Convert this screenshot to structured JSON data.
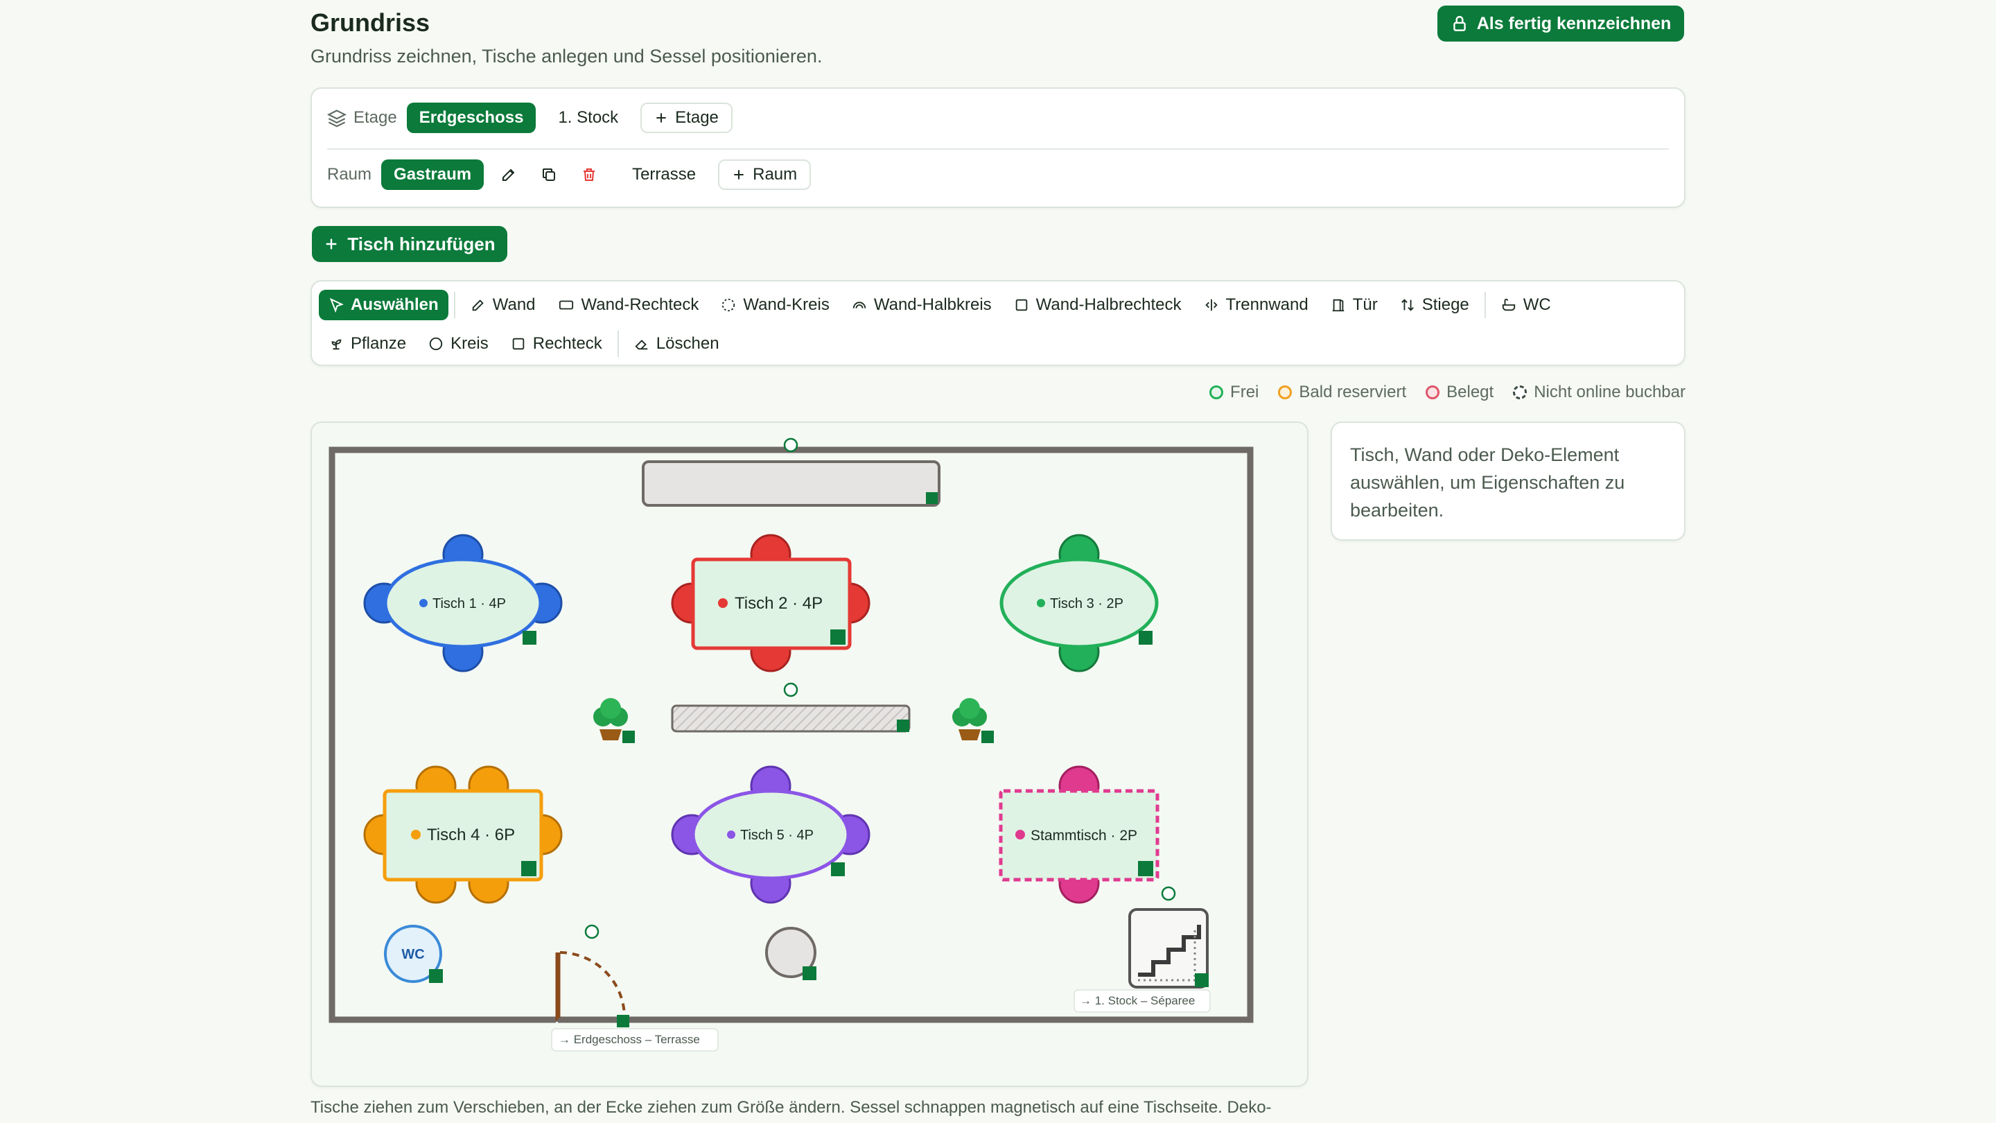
{
  "header": {
    "title": "Grundriss",
    "subtitle": "Grundriss zeichnen, Tische anlegen und Sessel positionieren.",
    "done_button": "Als fertig kennzeichnen"
  },
  "floors": {
    "label": "Etage",
    "items": [
      "Erdgeschoss",
      "1. Stock"
    ],
    "active": "Erdgeschoss",
    "add_label": "Etage"
  },
  "rooms": {
    "label": "Raum",
    "items": [
      "Gastraum",
      "Terrasse"
    ],
    "active": "Gastraum",
    "add_label": "Raum"
  },
  "add_table_button": "Tisch hinzufügen",
  "tools": {
    "row1": [
      {
        "label": "Auswählen",
        "icon": "cursor-icon",
        "active": true
      },
      {
        "label": "Wand",
        "icon": "pencil-icon"
      },
      {
        "label": "Wand-Rechteck",
        "icon": "rectangle-icon"
      },
      {
        "label": "Wand-Kreis",
        "icon": "dashed-circle-icon"
      },
      {
        "label": "Wand-Halbkreis",
        "icon": "half-circle-icon"
      },
      {
        "label": "Wand-Halbrechteck",
        "icon": "square-icon"
      },
      {
        "label": "Trennwand",
        "icon": "divider-icon"
      },
      {
        "label": "Tür",
        "icon": "door-icon"
      },
      {
        "label": "Stiege",
        "icon": "stairs-arrows-icon"
      },
      {
        "label": "WC",
        "icon": "bathtub-icon"
      }
    ],
    "row2": [
      {
        "label": "Pflanze",
        "icon": "sprout-icon"
      },
      {
        "label": "Kreis",
        "icon": "circle-icon"
      },
      {
        "label": "Rechteck",
        "icon": "square-icon"
      },
      {
        "label": "Löschen",
        "icon": "eraser-icon"
      }
    ]
  },
  "legend": {
    "free": "Frei",
    "soon": "Bald reserviert",
    "occupied": "Belegt",
    "offline": "Nicht online buchbar",
    "colors": {
      "free": "#22b05a",
      "soon": "#f0a020",
      "occupied": "#e0566a",
      "offline": "#3a4a40"
    }
  },
  "tables": [
    {
      "label": "Tisch 1 · 4P",
      "color": "#2f6fe0"
    },
    {
      "label": "Tisch 2 · 4P",
      "color": "#e53935"
    },
    {
      "label": "Tisch 3 · 2P",
      "color": "#22b05a"
    },
    {
      "label": "Tisch 4 · 6P",
      "color": "#f59e0b"
    },
    {
      "label": "Tisch 5 · 4P",
      "color": "#8b55e6"
    },
    {
      "label": "Stammtisch · 2P",
      "color": "#e03a8f"
    }
  ],
  "deco": {
    "wc_label": "WC",
    "door_link": "→ Erdgeschoss – Terrasse",
    "stairs_link": "→ 1. Stock – Séparee"
  },
  "properties_hint": "Tisch, Wand oder Deko-Element auswählen, um Eigenschaften zu bearbeiten.",
  "footer_note": "Tische ziehen zum Verschieben, an der Ecke ziehen zum Größe ändern. Sessel schnappen magnetisch auf eine Tischseite. Deko-",
  "colors": {
    "accent": "#0b7a3a",
    "wall": "#6f6a66",
    "delete": "#e53935"
  }
}
